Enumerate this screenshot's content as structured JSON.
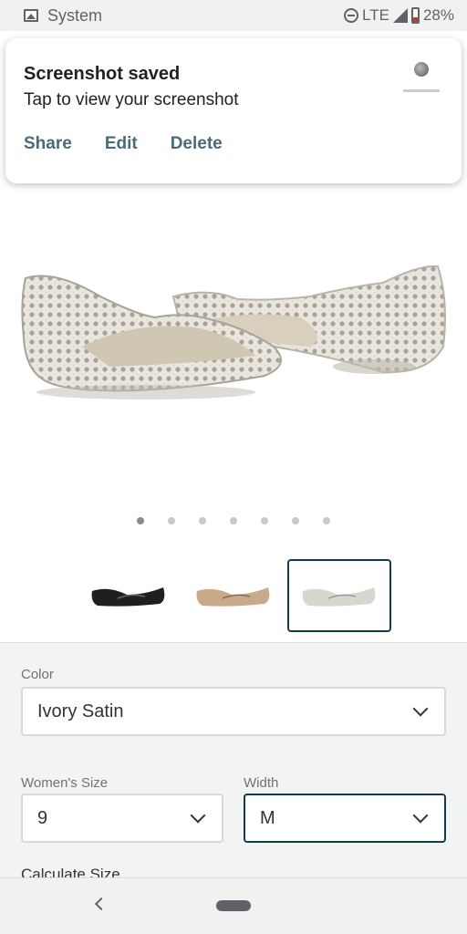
{
  "status_bar": {
    "app_label": "System",
    "network": "LTE",
    "battery": "28%"
  },
  "notification": {
    "title": "Screenshot saved",
    "body": "Tap to view your screenshot",
    "actions": [
      "Share",
      "Edit",
      "Delete"
    ]
  },
  "product": {
    "image_count": 7,
    "active_image_index": 0,
    "thumbnails": [
      {
        "color": "black",
        "selected": false
      },
      {
        "color": "champagne",
        "selected": false
      },
      {
        "color": "ivory",
        "selected": true
      }
    ]
  },
  "options": {
    "color": {
      "label": "Color",
      "value": "Ivory Satin"
    },
    "size": {
      "label": "Women's Size",
      "value": "9"
    },
    "width": {
      "label": "Width",
      "value": "M"
    },
    "calculate_size": "Calculate Size"
  },
  "colors": {
    "accent": "#0f3d4c",
    "action_text": "#4a6b76",
    "panel_bg": "#f2f3f3"
  }
}
